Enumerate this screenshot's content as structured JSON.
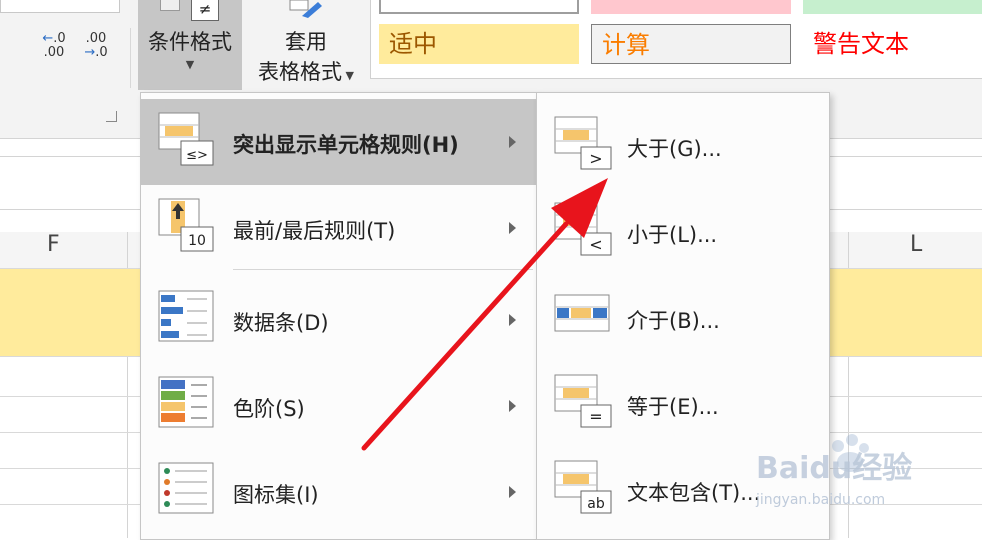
{
  "ribbon": {
    "num_increase": ".00",
    "num_increase_sub": ".0",
    "num_decrease": ".00",
    "num_decrease_sub": ".0",
    "cond_format_icon_text": "≠",
    "cond_format_label": "条件格式",
    "format_table_label_1": "套用",
    "format_table_label_2": "表格格式",
    "styles": {
      "neutral": "适中",
      "calculation": "计算",
      "warning": "警告文本"
    }
  },
  "sheet": {
    "columns": [
      "F",
      "L"
    ]
  },
  "menu": {
    "items": [
      {
        "label": "突出显示单元格规则(H)",
        "icon": "highlight-rules-icon",
        "icon_text": "≤>"
      },
      {
        "label": "最前/最后规则(T)",
        "icon": "top-bottom-rules-icon",
        "icon_text": "10"
      },
      {
        "label": "数据条(D)",
        "icon": "data-bars-icon"
      },
      {
        "label": "色阶(S)",
        "icon": "color-scales-icon"
      },
      {
        "label": "图标集(I)",
        "icon": "icon-sets-icon"
      }
    ]
  },
  "submenu": {
    "items": [
      {
        "label": "大于(G)...",
        "icon": "greater-than-icon",
        "icon_text": ">"
      },
      {
        "label": "小于(L)...",
        "icon": "less-than-icon",
        "icon_text": "<"
      },
      {
        "label": "介于(B)...",
        "icon": "between-icon"
      },
      {
        "label": "等于(E)...",
        "icon": "equal-to-icon",
        "icon_text": "="
      },
      {
        "label": "文本包含(T)...",
        "icon": "text-contains-icon",
        "icon_text": "ab"
      }
    ]
  },
  "watermark": {
    "brand": "Baidu经验",
    "url": "jingyan.baidu.com"
  },
  "colors": {
    "menu_highlight": "#c6c6c6",
    "neutral_fill": "#ffeb9c",
    "neutral_text": "#9c5700",
    "calc_text": "#fa7d00",
    "warn_text": "#ff0000",
    "annotation_arrow": "#e8141c"
  }
}
